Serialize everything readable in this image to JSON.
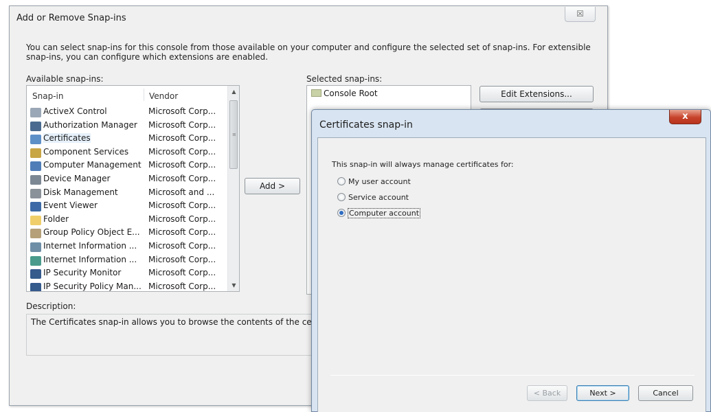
{
  "main_dialog": {
    "title": "Add or Remove Snap-ins",
    "close_glyph": "☒",
    "intro_line1": "You can select snap-ins for this console from those available on your computer and configure the selected set of snap-ins. For extensible",
    "intro_line2": "snap-ins, you can configure which extensions are enabled.",
    "available_label": "Available snap-ins:",
    "columns": {
      "snapin": "Snap-in",
      "vendor": "Vendor"
    },
    "snapins": [
      {
        "name": "ActiveX Control",
        "vendor": "Microsoft Corp...",
        "icon": "activex-icon",
        "color": "#9aa7b6"
      },
      {
        "name": "Authorization Manager",
        "vendor": "Microsoft Corp...",
        "icon": "authorization-icon",
        "color": "#4a6b8f"
      },
      {
        "name": "Certificates",
        "vendor": "Microsoft Corp...",
        "icon": "certificate-icon",
        "color": "#5e90c8"
      },
      {
        "name": "Component Services",
        "vendor": "Microsoft Corp...",
        "icon": "component-services-icon",
        "color": "#c8a545"
      },
      {
        "name": "Computer Management",
        "vendor": "Microsoft Corp...",
        "icon": "computer-management-icon",
        "color": "#4f7db8"
      },
      {
        "name": "Device Manager",
        "vendor": "Microsoft Corp...",
        "icon": "device-manager-icon",
        "color": "#7c8894"
      },
      {
        "name": "Disk Management",
        "vendor": "Microsoft and ...",
        "icon": "disk-management-icon",
        "color": "#8a9199"
      },
      {
        "name": "Event Viewer",
        "vendor": "Microsoft Corp...",
        "icon": "event-viewer-icon",
        "color": "#3d6aa6"
      },
      {
        "name": "Folder",
        "vendor": "Microsoft Corp...",
        "icon": "folder-icon",
        "color": "#f0cf6b"
      },
      {
        "name": "Group Policy Object E...",
        "vendor": "Microsoft Corp...",
        "icon": "group-policy-icon",
        "color": "#b5a07a"
      },
      {
        "name": "Internet Information ...",
        "vendor": "Microsoft Corp...",
        "icon": "iis-icon",
        "color": "#6f8fa7"
      },
      {
        "name": "Internet Information ...",
        "vendor": "Microsoft Corp...",
        "icon": "iis-icon",
        "color": "#4a9b8c"
      },
      {
        "name": "IP Security Monitor",
        "vendor": "Microsoft Corp...",
        "icon": "ip-security-icon",
        "color": "#355a8c"
      },
      {
        "name": "IP Security Policy Man...",
        "vendor": "Microsoft Corp...",
        "icon": "ip-security-policy-icon",
        "color": "#355a8c"
      }
    ],
    "add_button": "Add >",
    "selected_label": "Selected snap-ins:",
    "selected_items": [
      {
        "name": "Console Root",
        "icon": "console-root-icon"
      }
    ],
    "edit_extensions_button": "Edit Extensions...",
    "description_label": "Description:",
    "description_text": "The Certificates snap-in allows you to browse the contents of the cer"
  },
  "cert_dialog": {
    "title": "Certificates snap-in",
    "close_glyph": "x",
    "prompt": "This snap-in will always manage certificates for:",
    "options": [
      {
        "label": "My user account",
        "checked": false
      },
      {
        "label": "Service account",
        "checked": false
      },
      {
        "label": "Computer account",
        "checked": true
      }
    ],
    "back_button": "< Back",
    "next_button": "Next >",
    "cancel_button": "Cancel"
  }
}
